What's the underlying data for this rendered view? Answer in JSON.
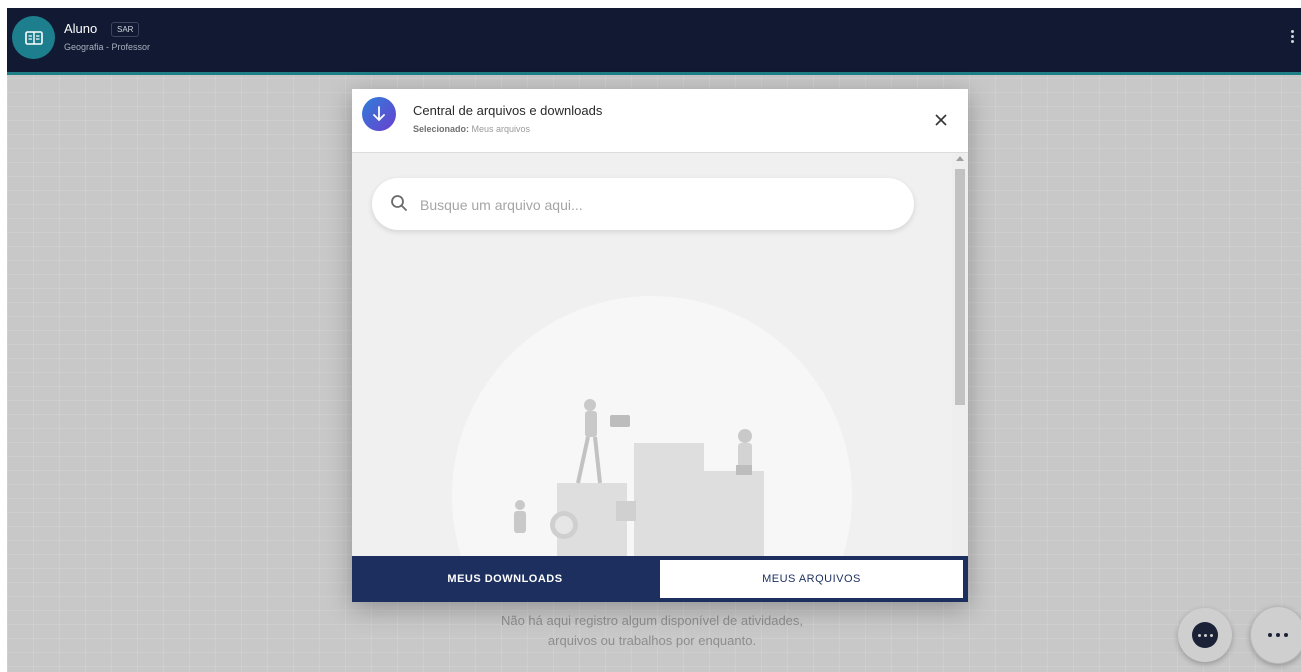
{
  "header": {
    "title": "Aluno",
    "badge": "SAR",
    "subtitle": "Geografia - Professor"
  },
  "modal": {
    "title": "Central de arquivos e downloads",
    "selected_label": "Selecionado:",
    "selected_value": "Meus arquivos",
    "search_placeholder": "Busque um arquivo aqui...",
    "tabs": [
      {
        "label": "MEUS DOWNLOADS",
        "active": false
      },
      {
        "label": "MEUS ARQUIVOS",
        "active": true
      }
    ]
  },
  "empty_state": {
    "line1": "Não há aqui registro algum disponível de atividades,",
    "line2": "arquivos ou trabalhos por enquanto."
  },
  "icons": {
    "app": "book-icon",
    "download": "arrow-down-icon",
    "close": "close-icon",
    "search": "search-icon",
    "chat": "chat-icon",
    "more": "more-horizontal-icon"
  },
  "colors": {
    "topbar": "#121a33",
    "accent_teal": "#1d7f8e",
    "tab_bar": "#1c2f5e"
  }
}
